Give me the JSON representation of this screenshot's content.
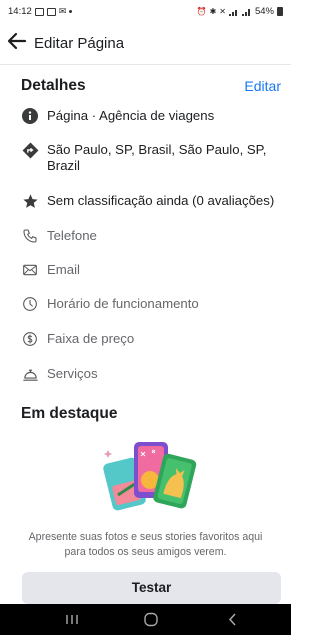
{
  "status_bar": {
    "time": "14:12",
    "battery": "54%",
    "notification_icons": [
      "image-icon",
      "gallery-icon",
      "mail-icon",
      "dot-icon"
    ],
    "system_icons": [
      "alarm-icon",
      "bluetooth-icon",
      "mute-icon",
      "volte-icon",
      "signal-icon",
      "signal-icon",
      "battery-icon"
    ]
  },
  "app_bar": {
    "title": "Editar Página",
    "back_icon": "arrow-left-icon"
  },
  "details": {
    "heading": "Detalhes",
    "edit_label": "Editar",
    "items": [
      {
        "icon": "info-icon",
        "text": "Página · Agência de viagens"
      },
      {
        "icon": "directions-icon",
        "text": "São Paulo, SP, Brasil, São Paulo, SP, Brazil"
      },
      {
        "icon": "star-icon",
        "text": "Sem classificação ainda (0 avaliações)"
      },
      {
        "icon": "phone-icon",
        "text": "Telefone"
      },
      {
        "icon": "email-icon",
        "text": "Email"
      },
      {
        "icon": "clock-icon",
        "text": "Horário de funcionamento"
      },
      {
        "icon": "dollar-icon",
        "text": "Faixa de preço"
      },
      {
        "icon": "service-bell-icon",
        "text": "Serviços"
      }
    ]
  },
  "featured": {
    "heading": "Em destaque",
    "description": "Apresente suas fotos e seus stories favoritos aqui para todos os seus amigos verem.",
    "button_label": "Testar"
  },
  "nav_bar": {
    "buttons": [
      "recent-apps-icon",
      "home-icon",
      "back-icon"
    ]
  },
  "colors": {
    "accent": "#1877f2",
    "text": "#1c1e21",
    "muted": "#65676b",
    "button_bg": "#e4e6eb"
  }
}
